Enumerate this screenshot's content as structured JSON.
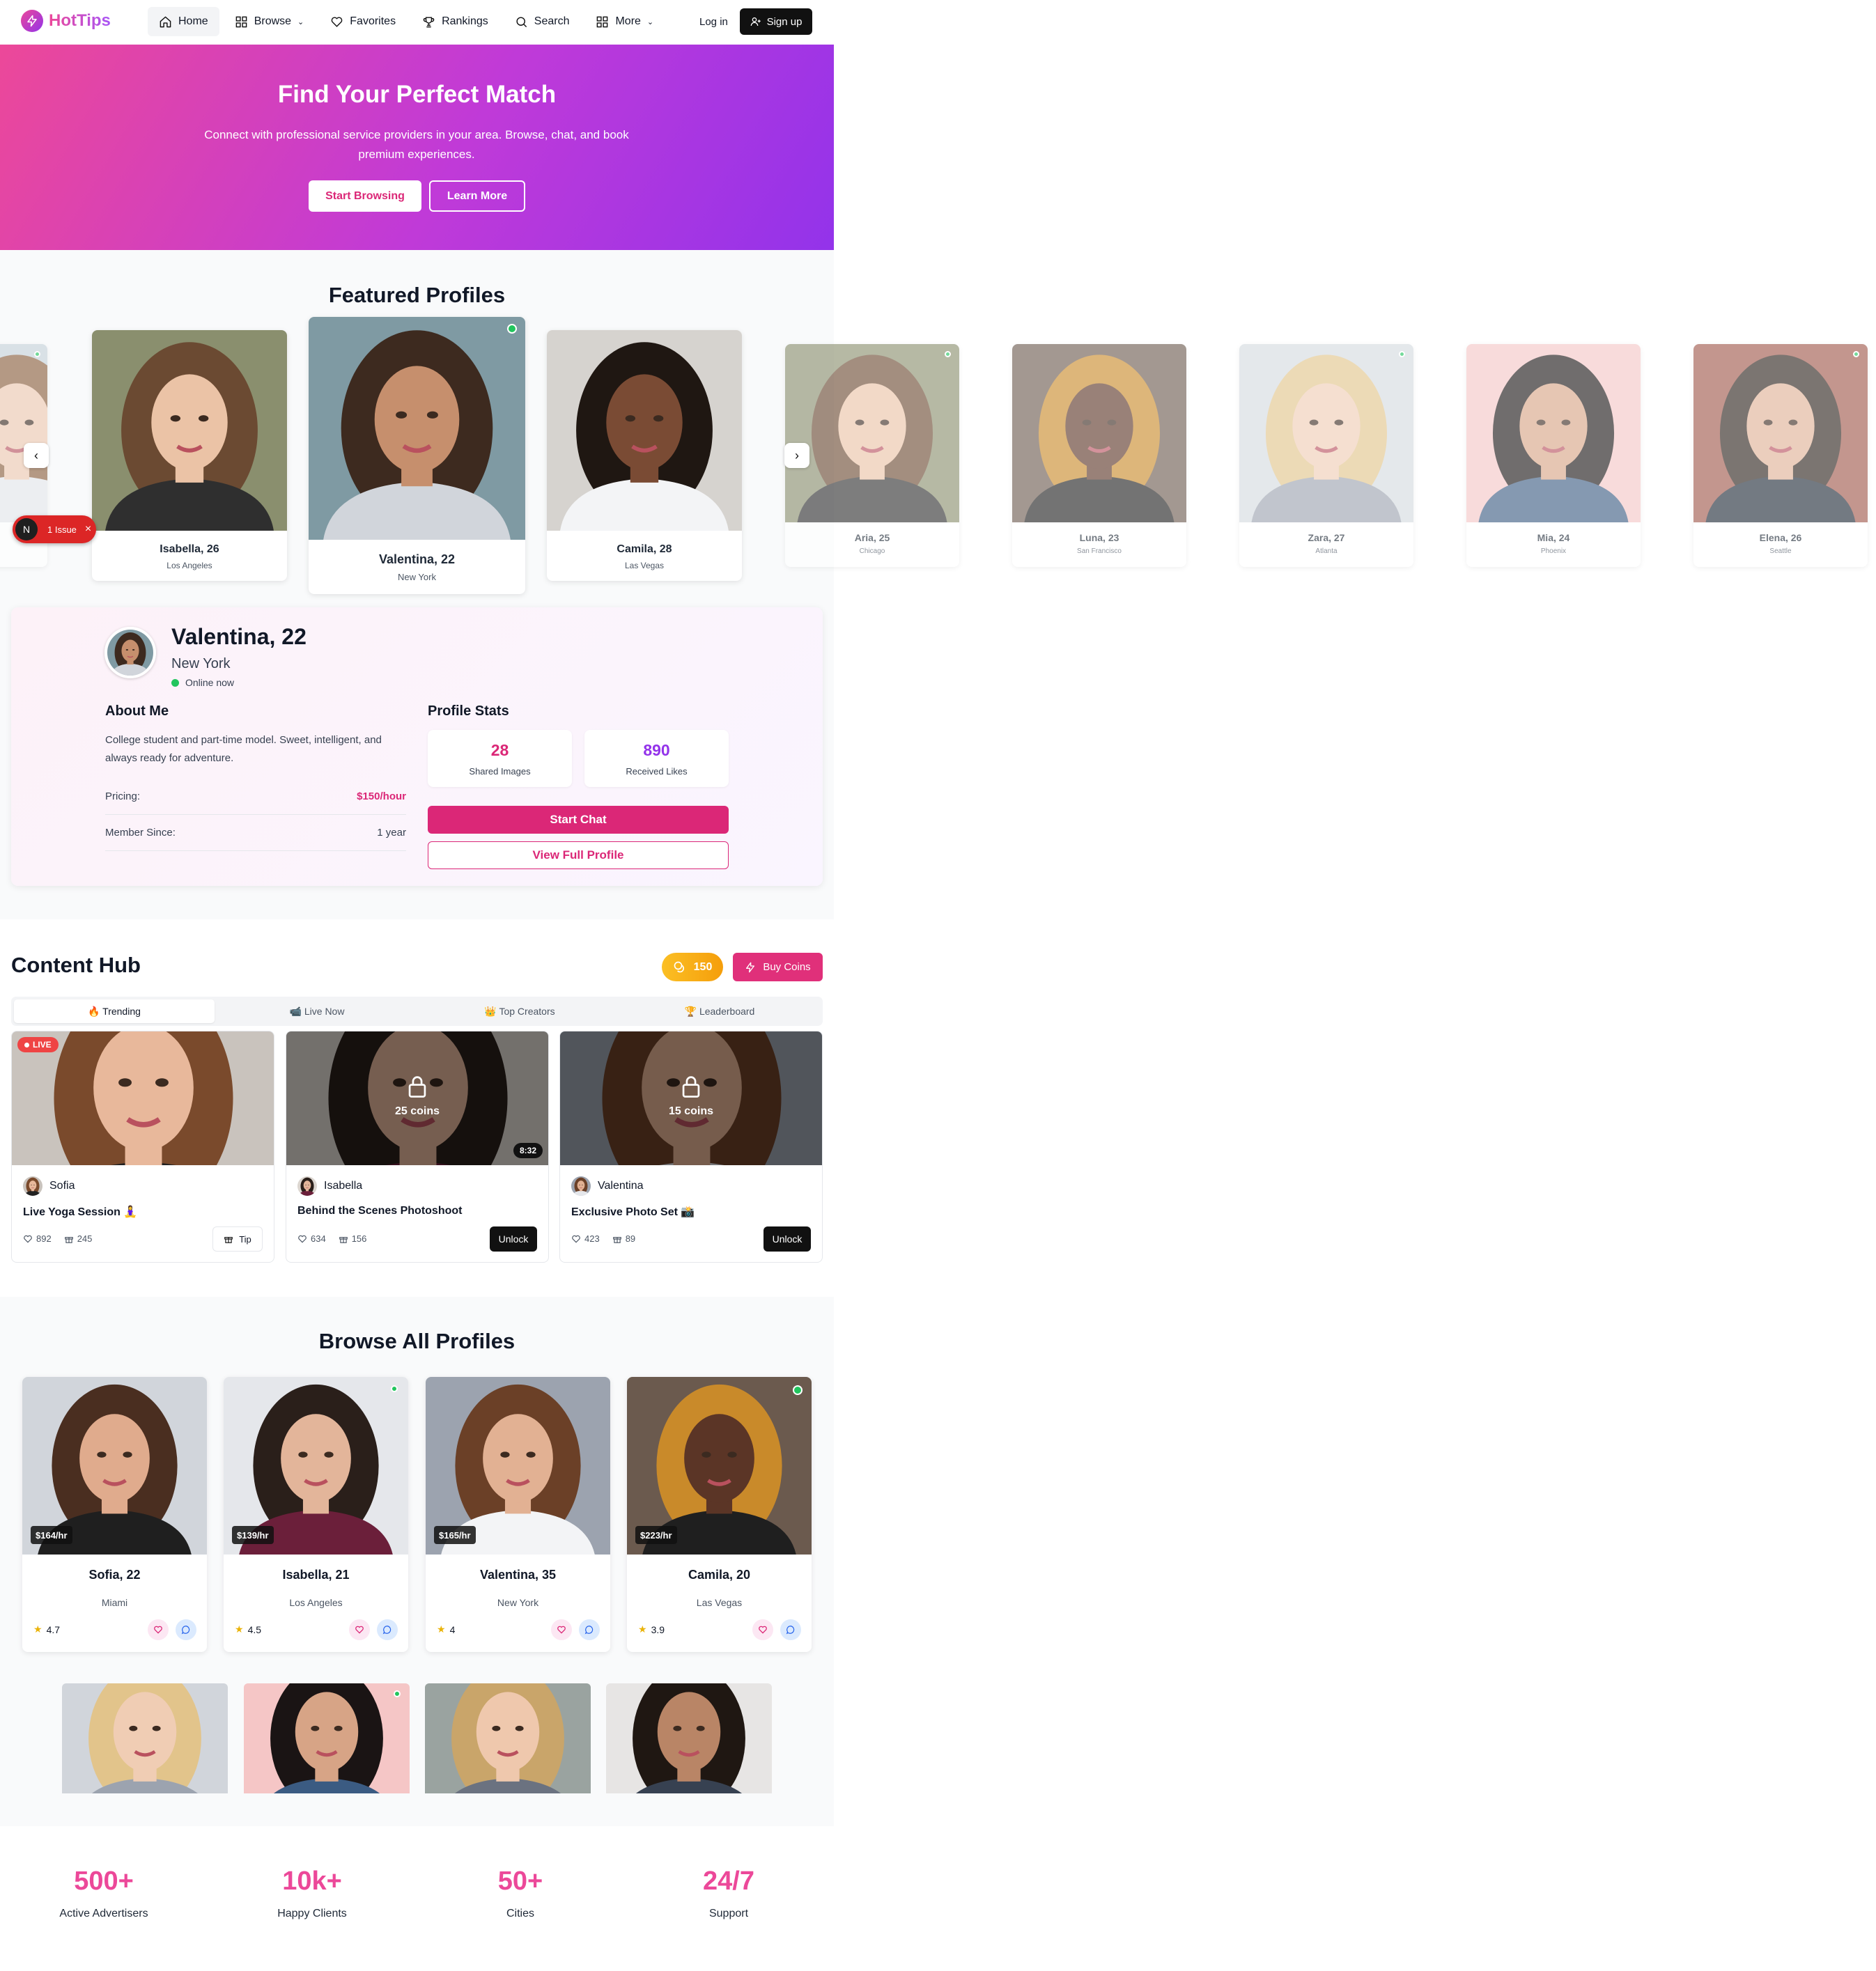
{
  "nav": {
    "logo": "HotTips",
    "items": [
      {
        "label": "Home",
        "icon": "home-icon",
        "active": true
      },
      {
        "label": "Browse",
        "icon": "grid-icon",
        "chevron": true
      },
      {
        "label": "Favorites",
        "icon": "heart-icon"
      },
      {
        "label": "Rankings",
        "icon": "trophy-icon"
      },
      {
        "label": "Search",
        "icon": "search-icon"
      },
      {
        "label": "More",
        "icon": "grid-icon",
        "chevron": true
      }
    ],
    "login": "Log in",
    "signup": "Sign up"
  },
  "hero": {
    "title": "Find Your Perfect Match",
    "subtitle": "Connect with professional service providers in your area. Browse, chat, and book premium experiences.",
    "primary_button": "Start Browsing",
    "secondary_button": "Learn More"
  },
  "featured": {
    "title": "Featured Profiles",
    "cards": [
      {
        "name": "Isabella, 26",
        "city": "Los Angeles"
      },
      {
        "name": "Valentina, 22",
        "city": "New York"
      },
      {
        "name": "Camila, 28",
        "city": "Las Vegas"
      },
      {
        "name": "Aria, 25",
        "city": "Chicago"
      },
      {
        "name": "Luna, 23",
        "city": "San Francisco"
      },
      {
        "name": "Zara, 27",
        "city": "Atlanta"
      },
      {
        "name": "Mia, 24",
        "city": "Phoenix"
      },
      {
        "name": "Elena, 26",
        "city": "Seattle"
      }
    ],
    "prev_arrow": "‹",
    "next_arrow": "›",
    "issue_badge": {
      "letter": "N",
      "label": "1 Issue",
      "close": "×"
    }
  },
  "detail": {
    "name": "Valentina, 22",
    "city": "New York",
    "status": "Online now",
    "about_heading": "About Me",
    "about": "College student and part-time model. Sweet, intelligent, and always ready for adventure.",
    "pricing_label": "Pricing:",
    "pricing_value": "$150/hour",
    "member_label": "Member Since:",
    "member_value": "1 year",
    "stats_heading": "Profile Stats",
    "stats": [
      {
        "value": "28",
        "label": "Shared Images",
        "color": "#db2777"
      },
      {
        "value": "890",
        "label": "Received Likes",
        "color": "#9333ea"
      }
    ],
    "start_chat": "Start Chat",
    "view_profile": "View Full Profile"
  },
  "hub": {
    "title": "Content Hub",
    "coins": "150",
    "buy_coins": "Buy Coins",
    "tabs": [
      "🔥 Trending",
      "📹 Live Now",
      "👑 Top Creators",
      "🏆 Leaderboard"
    ],
    "cards": [
      {
        "creator": "Sofia",
        "title": "Live Yoga Session 🧘‍♀️",
        "likes": "892",
        "gifts": "245",
        "badge": "LIVE",
        "action": "Tip"
      },
      {
        "creator": "Isabella",
        "title": "Behind the Scenes Photoshoot",
        "likes": "634",
        "gifts": "156",
        "lock": "25 coins",
        "duration": "8:32",
        "action": "Unlock"
      },
      {
        "creator": "Valentina",
        "title": "Exclusive Photo Set 📸",
        "likes": "423",
        "gifts": "89",
        "lock": "15 coins",
        "action": "Unlock"
      }
    ]
  },
  "browse": {
    "title": "Browse All Profiles",
    "cards": [
      {
        "name": "Sofia, 22",
        "city": "Miami",
        "price": "$164/hr",
        "rating": "4.7"
      },
      {
        "name": "Isabella, 21",
        "city": "Los Angeles",
        "price": "$139/hr",
        "rating": "4.5"
      },
      {
        "name": "Valentina, 35",
        "city": "New York",
        "price": "$165/hr",
        "rating": "4"
      },
      {
        "name": "Camila, 20",
        "city": "Las Vegas",
        "price": "$223/hr",
        "rating": "3.9"
      }
    ]
  },
  "stats": [
    {
      "value": "500+",
      "label": "Active Advertisers"
    },
    {
      "value": "10k+",
      "label": "Happy Clients"
    },
    {
      "value": "50+",
      "label": "Cities"
    },
    {
      "value": "24/7",
      "label": "Support"
    }
  ],
  "colors": {
    "accent": "#db2777",
    "purple": "#9333ea",
    "online": "#22c55e",
    "coin": "#f59e0b"
  }
}
